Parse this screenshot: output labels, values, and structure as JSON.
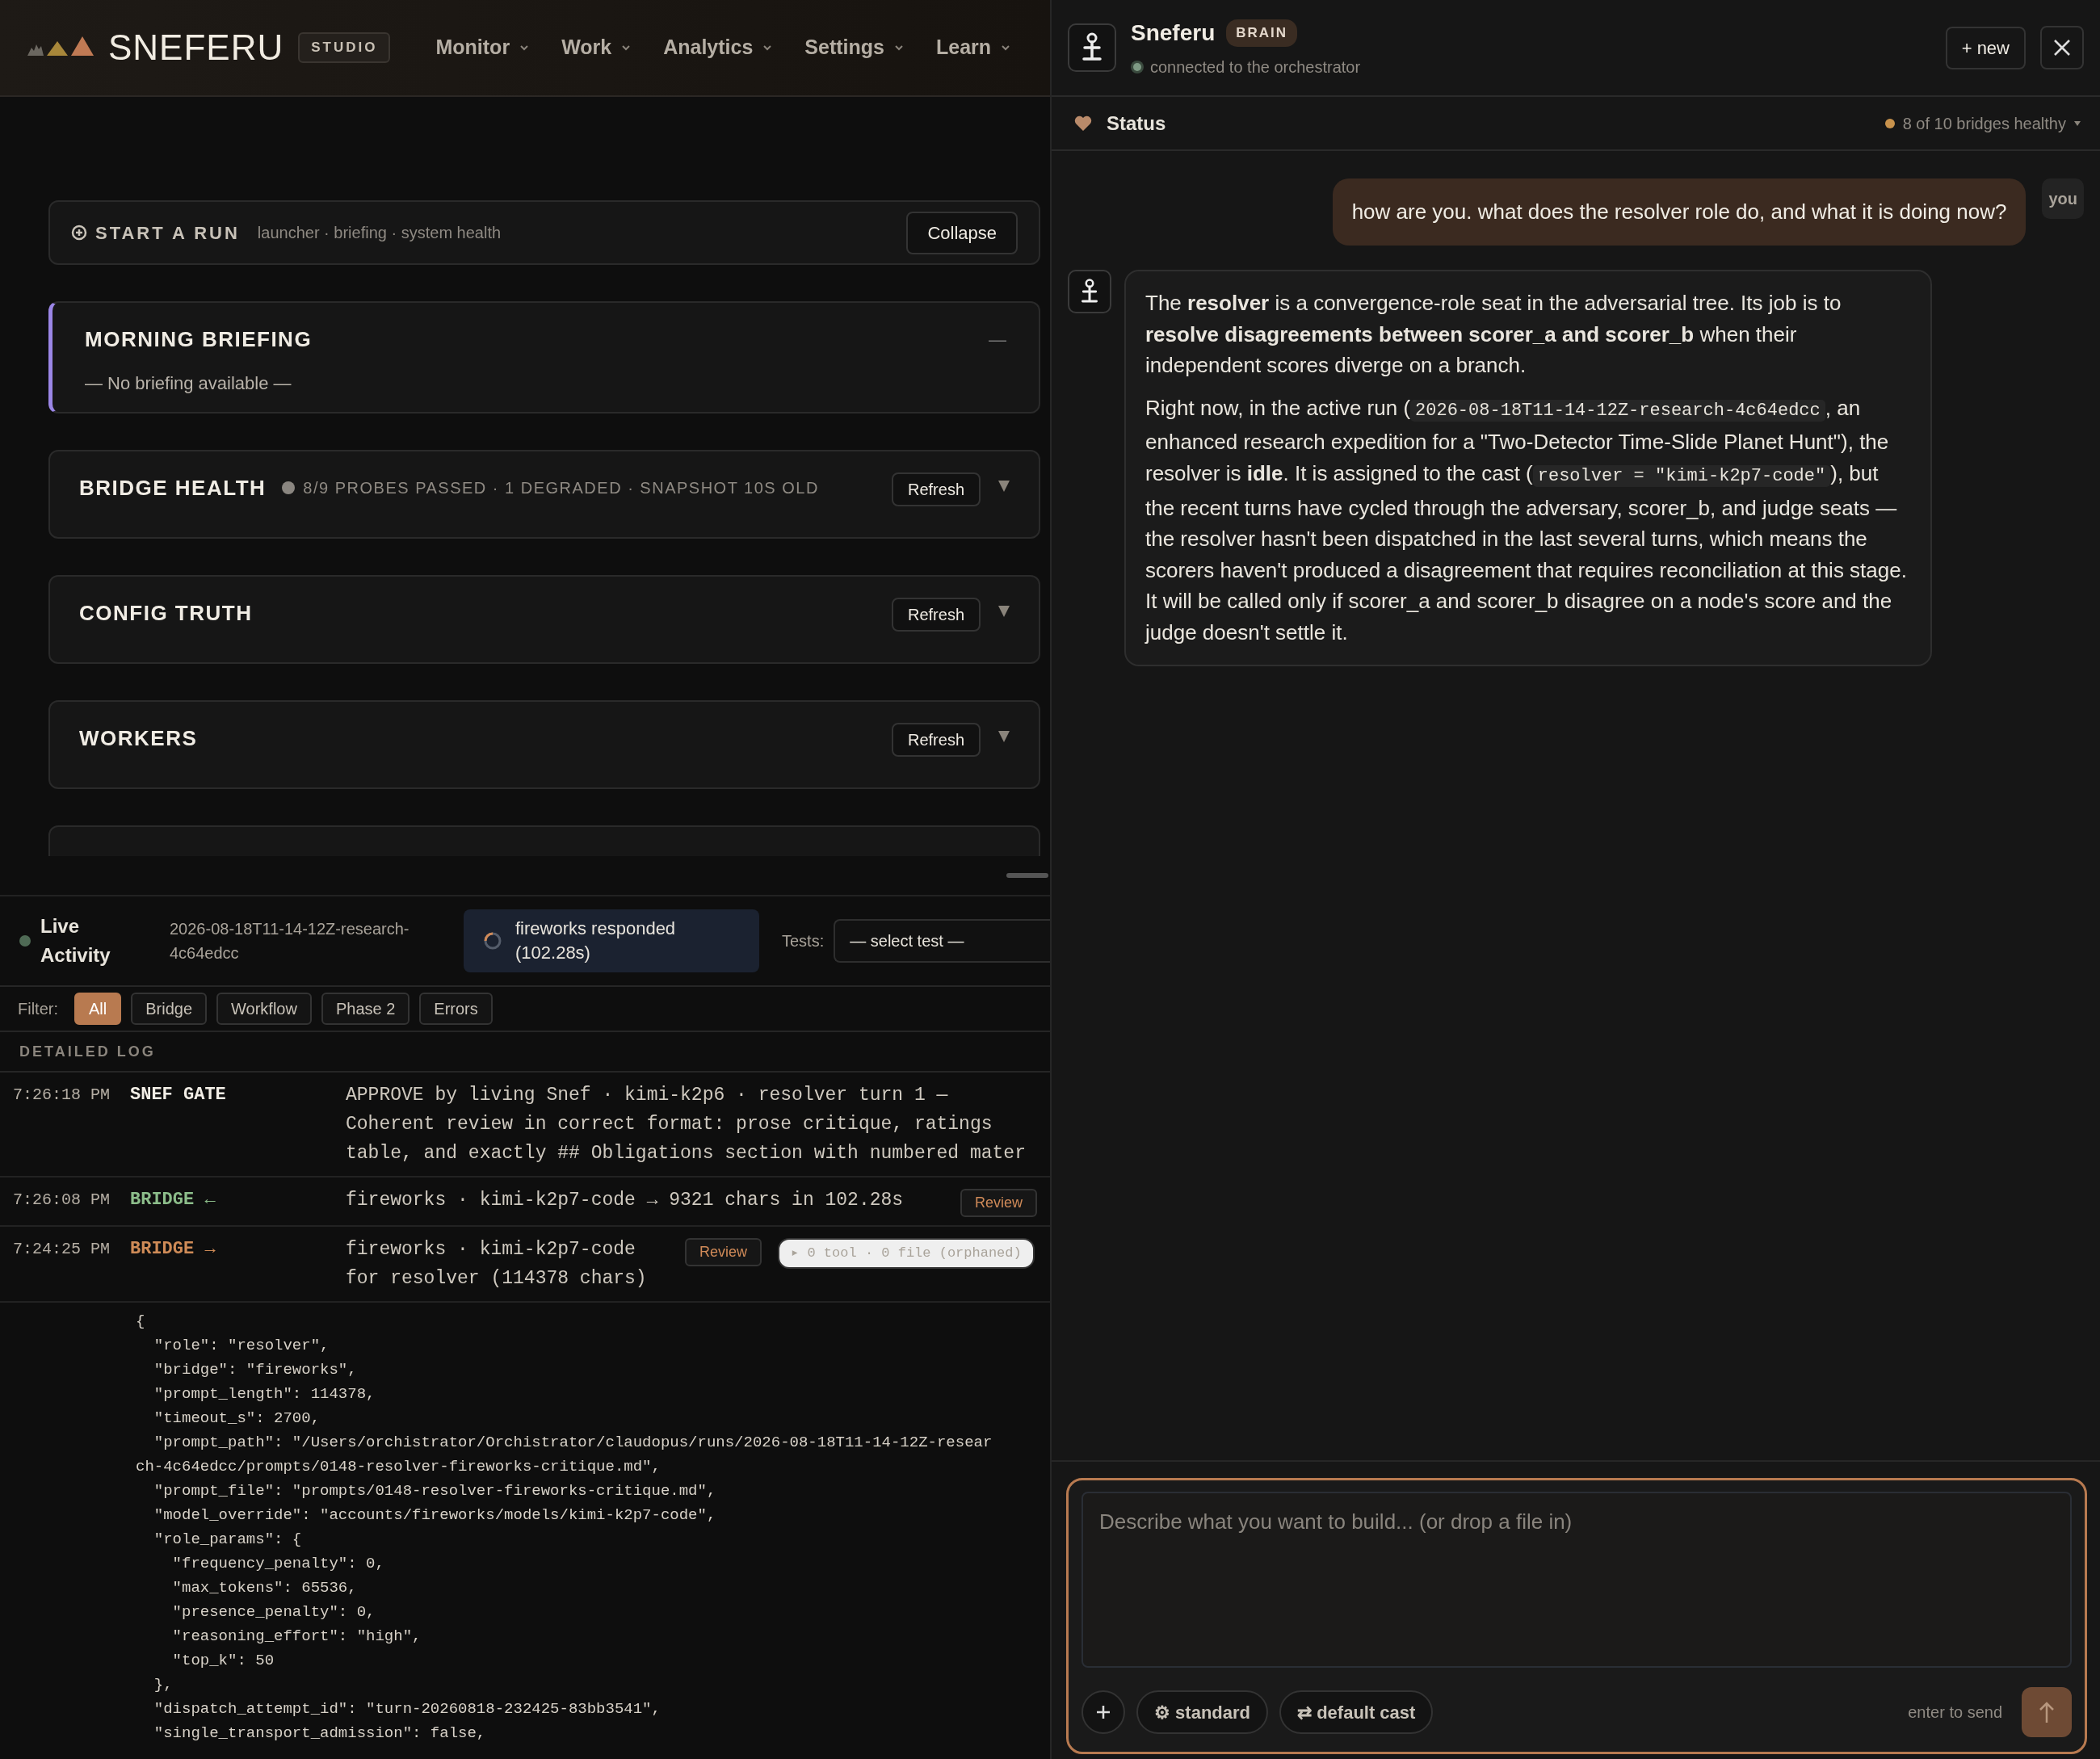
{
  "header": {
    "logo": "SNEFERU",
    "badge": "STUDIO",
    "nav": [
      {
        "label": "Monitor"
      },
      {
        "label": "Work"
      },
      {
        "label": "Analytics"
      },
      {
        "label": "Settings"
      },
      {
        "label": "Learn"
      }
    ]
  },
  "launcher": {
    "title": "START A RUN",
    "subtitle": "launcher · briefing · system health",
    "button": "Collapse"
  },
  "panels": [
    {
      "kind": "briefing",
      "title": "MORNING BRIEFING",
      "toggle": "—",
      "body": "— No briefing available —"
    },
    {
      "kind": "section",
      "title": "BRIDGE HEALTH",
      "summary": "8/9 PROBES PASSED · 1 DEGRADED · SNAPSHOT 10S OLD",
      "button": "Refresh"
    },
    {
      "kind": "section",
      "title": "CONFIG TRUTH",
      "button": "Refresh"
    },
    {
      "kind": "section",
      "title": "WORKERS",
      "button": "Refresh"
    },
    {
      "kind": "cut"
    }
  ],
  "live_activity": {
    "title": "Live Activity",
    "run_id": "2026-08-18T11-14-12Z-research-4c64edcc",
    "status": "fireworks responded (102.28s)",
    "tests_label": "Tests:",
    "tests_select": "— select test —"
  },
  "filter": {
    "label": "Filter:",
    "chips": [
      {
        "label": "All",
        "selected": true
      },
      {
        "label": "Bridge",
        "selected": false
      },
      {
        "label": "Workflow",
        "selected": false
      },
      {
        "label": "Phase 2",
        "selected": false
      },
      {
        "label": "Errors",
        "selected": false
      }
    ]
  },
  "log": {
    "heading": "DETAILED LOG",
    "entries": [
      {
        "time": "7:26:18 PM",
        "source": "SNEF GATE",
        "kind": "gate",
        "message": "APPROVE by living Snef · kimi-k2p6 · resolver turn 1 — Coherent review in correct format: prose critique, ratings table, and exactly ## Obligations section with numbered mater"
      },
      {
        "time": "7:26:08 PM",
        "source": "BRIDGE ←",
        "kind": "in",
        "message": "fireworks · kimi-k2p7-code → 9321 chars in 102.28s",
        "review": "Review"
      },
      {
        "time": "7:24:25 PM",
        "source": "BRIDGE →",
        "kind": "out",
        "message": "fireworks · kimi-k2p7-code for resolver (114378 chars)",
        "review": "Review",
        "tools": "▸ 0 tool · 0 file (orphaned)"
      }
    ],
    "detail": [
      "{",
      "  \"role\": \"resolver\",",
      "  \"bridge\": \"fireworks\",",
      "  \"prompt_length\": 114378,",
      "  \"timeout_s\": 2700,",
      "  \"prompt_path\": \"/Users/orchistrator/Orchistrator/claudopus/runs/2026-08-18T11-14-12Z-resear",
      "ch-4c64edcc/prompts/0148-resolver-fireworks-critique.md\",",
      "  \"prompt_file\": \"prompts/0148-resolver-fireworks-critique.md\",",
      "  \"model_override\": \"accounts/fireworks/models/kimi-k2p7-code\",",
      "  \"role_params\": {",
      "    \"frequency_penalty\": 0,",
      "    \"max_tokens\": 65536,",
      "    \"presence_penalty\": 0,",
      "    \"reasoning_effort\": \"high\",",
      "    \"top_k\": 50",
      "  },",
      "  \"dispatch_attempt_id\": \"turn-20260818-232425-83bb3541\",",
      "  \"single_transport_admission\": false,"
    ]
  },
  "assistant": {
    "name": "Sneferu",
    "badge": "BRAIN",
    "connection": "connected to the orchestrator",
    "new_button": "+ new"
  },
  "status": {
    "label": "Status",
    "summary": "8 of 10 bridges healthy"
  },
  "messages": [
    {
      "kind": "user",
      "text": "how are you. what does the resolver role do, and what it is doing now?",
      "tag": "you"
    },
    {
      "kind": "assistant",
      "paragraphs": [
        [
          {
            "kind": "text",
            "text": "The **resolver** is a convergence-role seat in the adversarial tree. Its job is to **resolve disagreements between scorer_a and scorer_b** when their independent scores diverge on a branch."
          }
        ],
        [
          {
            "kind": "text",
            "text": "Right now, in the active run ("
          },
          {
            "kind": "code",
            "text": "2026-08-18T11-14-12Z-research-4c64edcc"
          },
          {
            "kind": "text",
            "text": ", an enhanced research expedition for a \"Two-Detector Time-Slide Planet Hunt\"), the resolver is **idle**. It is assigned to the cast ("
          },
          {
            "kind": "code",
            "text": "resolver = \"kimi-k2p7-code\""
          },
          {
            "kind": "text",
            "text": "), but the recent turns have cycled through the adversary, scorer_b, and judge seats — the resolver hasn't been dispatched in the last several turns, which means the scorers haven't produced a disagreement that requires reconciliation at this stage. It will be called only if scorer_a and scorer_b disagree on a node's score and the judge doesn't settle it."
          }
        ]
      ]
    }
  ],
  "composer": {
    "placeholder": "Describe what you want to build... (or drop a file in)",
    "mode": "⚙ standard",
    "cast": "⇄ default cast",
    "hint": "enter to send"
  }
}
